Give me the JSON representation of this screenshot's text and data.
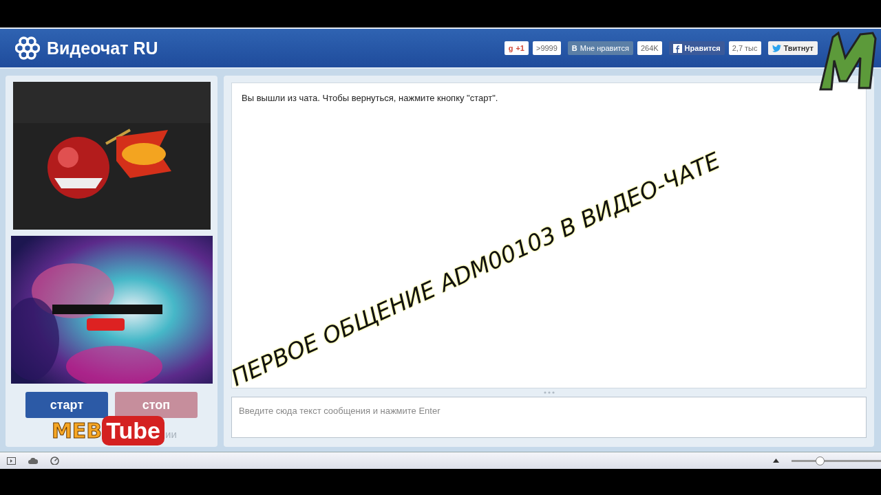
{
  "header": {
    "title": "Видеочат RU"
  },
  "social": [
    {
      "kind": "gplus",
      "label": "+1",
      "icon": "g",
      "count": ">9999"
    },
    {
      "kind": "vk",
      "icon": "В",
      "label": "Мне нравится",
      "count": "264K"
    },
    {
      "kind": "fb",
      "label": "Нравится",
      "count": "2,7 тыс"
    },
    {
      "kind": "tw",
      "label": "Твитнут"
    }
  ],
  "buttons": [
    {
      "label": "старт",
      "disabled": false
    },
    {
      "label": "стоп",
      "disabled": true
    }
  ],
  "hidden_link": "ии",
  "chat": {
    "message": "Вы вышли из чата. Чтобы вернуться, нажмите кнопку \"старт\".",
    "placeholder": "Введите сюда текст сообщения и нажмите Enter"
  },
  "overlay": {
    "title": "ПЕРВОЕ ОБЩЕНИЕ ADM00103 В ВИДЕО-ЧАТЕ",
    "logo_left": "MEB",
    "logo_right": "Tube"
  },
  "status_bar": {
    "zoom": {
      "level": 0.3
    }
  }
}
